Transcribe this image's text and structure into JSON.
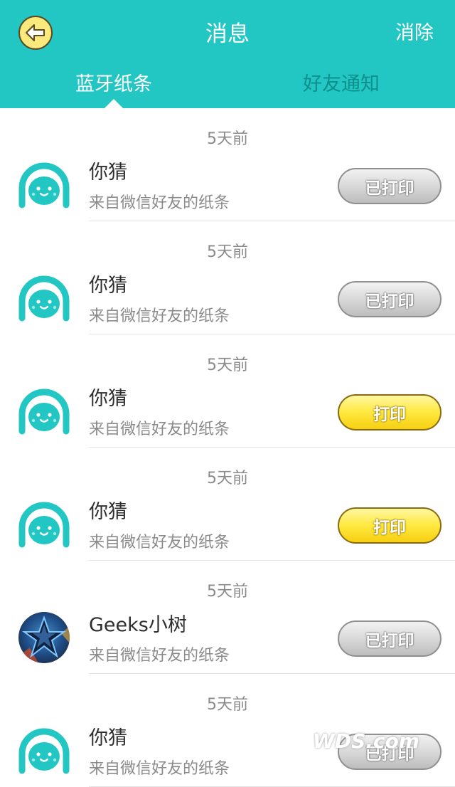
{
  "header": {
    "title": "消息",
    "clear_label": "消除",
    "back_icon": "back-arrow-icon",
    "background_color": "#22c6c3"
  },
  "tabs": [
    {
      "label": "蓝牙纸条",
      "active": true
    },
    {
      "label": "好友通知",
      "active": false
    }
  ],
  "messages": [
    {
      "time": "5天前",
      "name": "你猜",
      "source": "来自微信好友的纸条",
      "avatar": "default-face-avatar",
      "button": "已打印",
      "printed": true
    },
    {
      "time": "5天前",
      "name": "你猜",
      "source": "来自微信好友的纸条",
      "avatar": "default-face-avatar",
      "button": "已打印",
      "printed": true
    },
    {
      "time": "5天前",
      "name": "你猜",
      "source": "来自微信好友的纸条",
      "avatar": "default-face-avatar",
      "button": "打印",
      "printed": false
    },
    {
      "time": "5天前",
      "name": "你猜",
      "source": "来自微信好友的纸条",
      "avatar": "default-face-avatar",
      "button": "打印",
      "printed": false
    },
    {
      "time": "5天前",
      "name": "Geeks小树",
      "source": "来自微信好友的纸条",
      "avatar": "star-photo-avatar",
      "button": "已打印",
      "printed": true
    },
    {
      "time": "5天前",
      "name": "你猜",
      "source": "来自微信好友的纸条",
      "avatar": "default-face-avatar",
      "button": "已打印",
      "printed": true
    }
  ],
  "watermark": "WDS.com"
}
